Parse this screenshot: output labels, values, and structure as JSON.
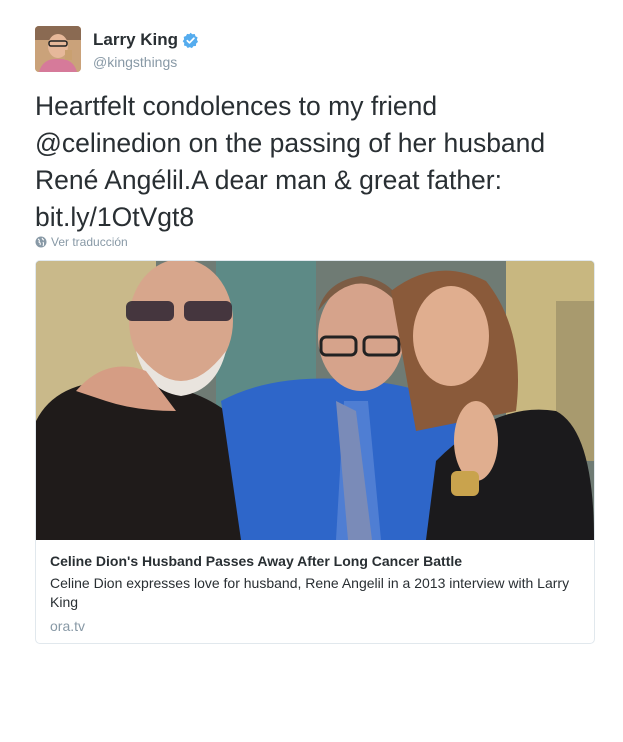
{
  "user": {
    "display_name": "Larry King",
    "handle": "@kingsthings",
    "verified": true,
    "avatar_icon": "profile-photo"
  },
  "tweet": {
    "text": "Heartfelt condolences to my friend\n@celinedion on the passing of her husband\nRené Angélil.A dear man & great father:\nbit.ly/1OtVgt8",
    "translate_label": "Ver traducción",
    "translate_icon": "globe-icon"
  },
  "card": {
    "title": "Celine Dion's Husband Passes Away After Long Cancer Battle",
    "description": "Celine Dion expresses love for husband, Rene Angelil in a 2013 interview with Larry King",
    "domain": "ora.tv"
  },
  "colors": {
    "verified_blue": "#55acee",
    "muted_text": "#8899a6",
    "text": "#292f33"
  }
}
